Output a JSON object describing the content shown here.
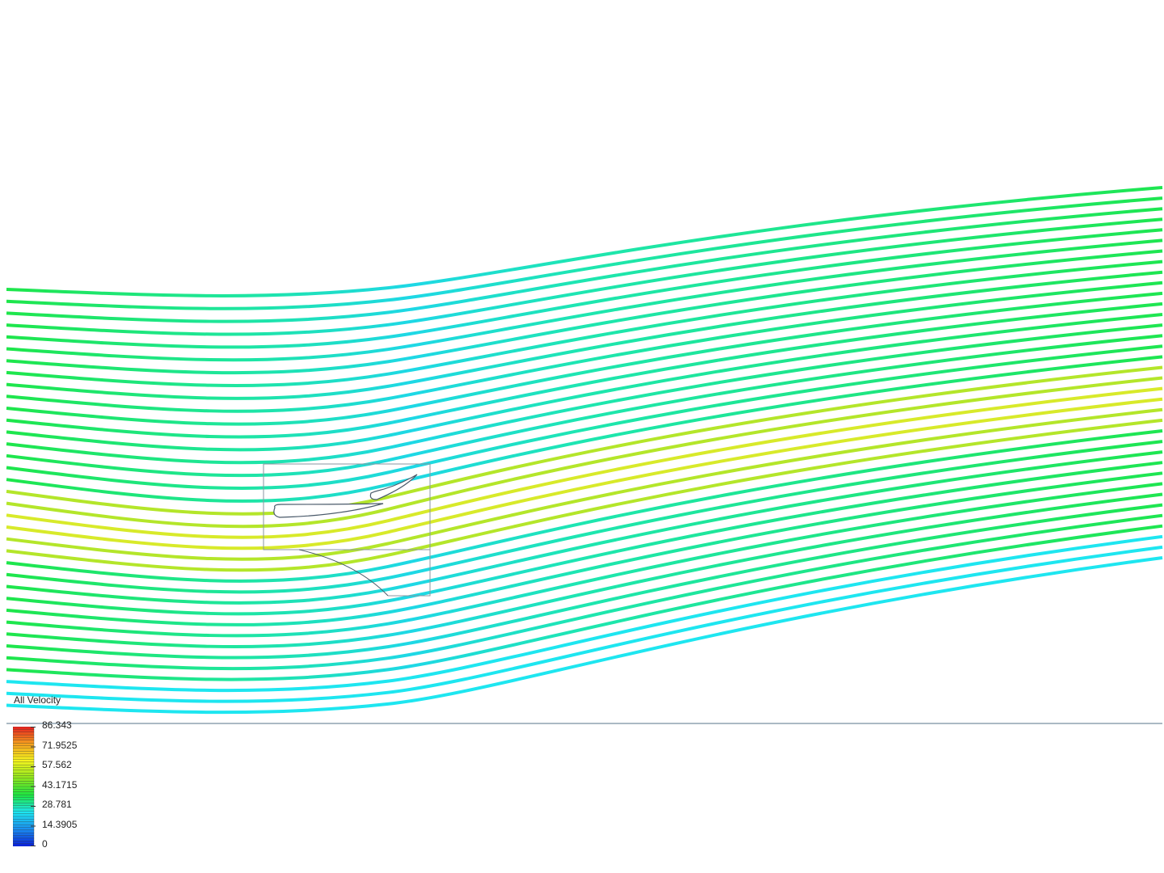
{
  "legend": {
    "title": "All Velocity",
    "max": 86.343,
    "ticks": [
      "86.343",
      "71.9525",
      "57.562",
      "43.1715",
      "28.781",
      "14.3905",
      "0"
    ],
    "bands": 44
  },
  "colors": {
    "background": "#ffffff",
    "geometry_outline": "#4a5a6a",
    "ground_line": "#8fa2b0",
    "colormap": [
      "#0a1fd6",
      "#1a8ef0",
      "#1ee6f0",
      "#1ee640",
      "#8ee61e",
      "#f5f51e",
      "#f5a01e",
      "#e61e1e"
    ]
  }
}
